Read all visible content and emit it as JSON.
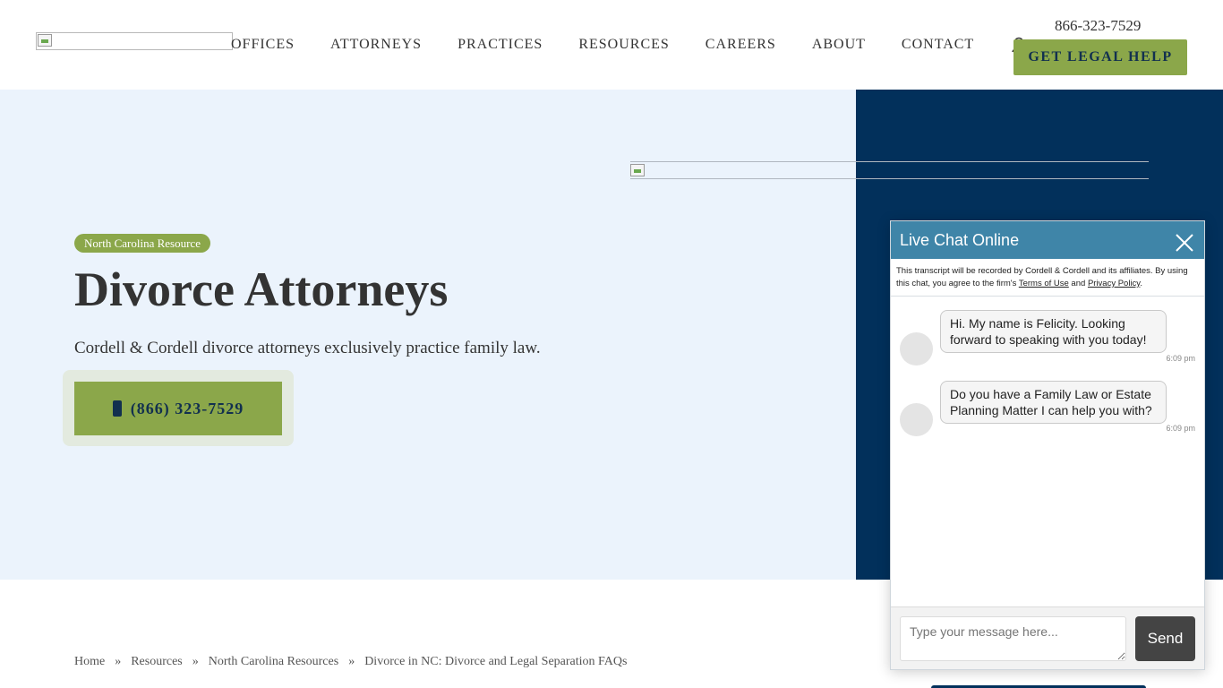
{
  "header": {
    "logo_alt": "",
    "nav": [
      "OFFICES",
      "ATTORNEYS",
      "PRACTICES",
      "RESOURCES",
      "CAREERS",
      "ABOUT",
      "CONTACT"
    ],
    "phone": "866-323-7529",
    "cta_label": "GET LEGAL HELP"
  },
  "hero": {
    "badge": "North Carolina Resource",
    "title": "Divorce Attorneys",
    "subtitle": "Cordell & Cordell divorce attorneys exclusively practice family law.",
    "phone_button": "(866) 323-7529"
  },
  "breadcrumb": {
    "items": [
      "Home",
      "Resources",
      "North Carolina Resources",
      "Divorce in NC: Divorce and Legal Separation FAQs"
    ],
    "separator": "»"
  },
  "chat": {
    "title": "Live Chat Online",
    "notice_prefix": "This transcript will be recorded by Cordell & Cordell and its affiliates. By using this chat, you agree to the firm's ",
    "terms_link": "Terms of Use",
    "notice_and": " and ",
    "privacy_link": "Privacy Policy",
    "notice_suffix": ".",
    "messages": [
      {
        "text": "Hi. My name is Felicity. Looking forward to speaking with you today!",
        "time": "6:09 pm"
      },
      {
        "text": "Do you have a Family Law or Estate Planning Matter I can help you with?",
        "time": "6:09 pm"
      }
    ],
    "input_placeholder": "Type your message here...",
    "send_label": "Send"
  },
  "colors": {
    "brand_green": "#8ba74a",
    "brand_navy": "#02305b",
    "hero_bg": "#ebf3fc",
    "chat_header": "#3f85a8"
  },
  "icons": {
    "user": "user-icon",
    "phone": "phone-icon",
    "close": "close-icon"
  }
}
